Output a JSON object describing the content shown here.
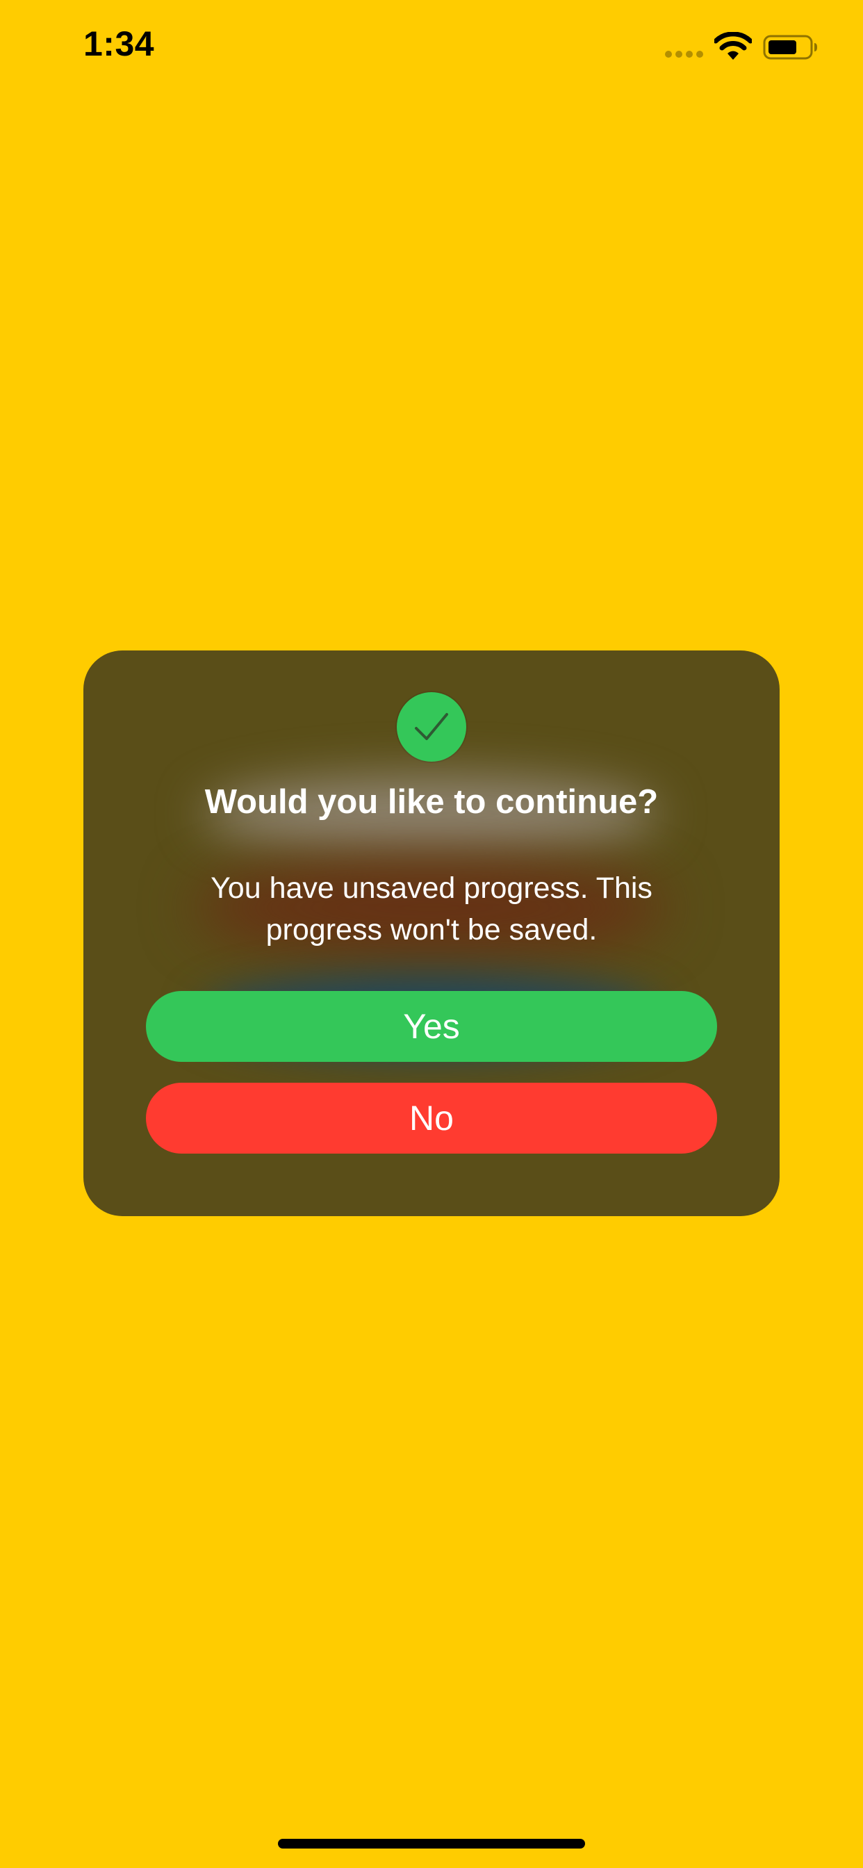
{
  "status_bar": {
    "time": "1:34"
  },
  "dialog": {
    "icon": "checkmark-icon",
    "title": "Would you like to continue?",
    "message": "You have unsaved progress.  This\nprogress won't be saved.",
    "yes_label": "Yes",
    "no_label": "No"
  },
  "colors": {
    "background": "#FFCC00",
    "dialog_background": "#5A4E18",
    "accent_green": "#34C759",
    "destructive_red": "#FF3B30",
    "text": "#FFFFFF"
  }
}
